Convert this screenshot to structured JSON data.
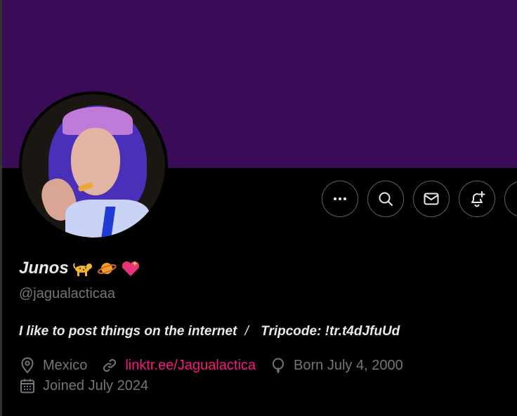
{
  "profile": {
    "display_name": "Junos",
    "name_emojis": [
      "cheetah-emoji",
      "ringed-planet-emoji",
      "sparkling-heart-emoji"
    ],
    "handle": "@jagualacticaa",
    "bio_main": "I like to post things on the internet",
    "bio_sep": "/",
    "bio_tripcode_label": "Tripcode",
    "bio_tripcode_value": ": !tr.t4dJfuUd",
    "location": "Mexico",
    "website": "linktr.ee/Jagualactica",
    "birthday": "Born July 4, 2000",
    "joined": "Joined July 2024"
  },
  "actions": {
    "icons": [
      "more-icon",
      "search-icon",
      "message-icon",
      "notification-add-icon",
      "partially-visible-button"
    ]
  },
  "colors": {
    "banner": "#3a0b57",
    "background": "#000000",
    "text": "#e7e9ea",
    "secondary_text": "#71767b",
    "link": "#f91880",
    "button_border": "#536471"
  }
}
